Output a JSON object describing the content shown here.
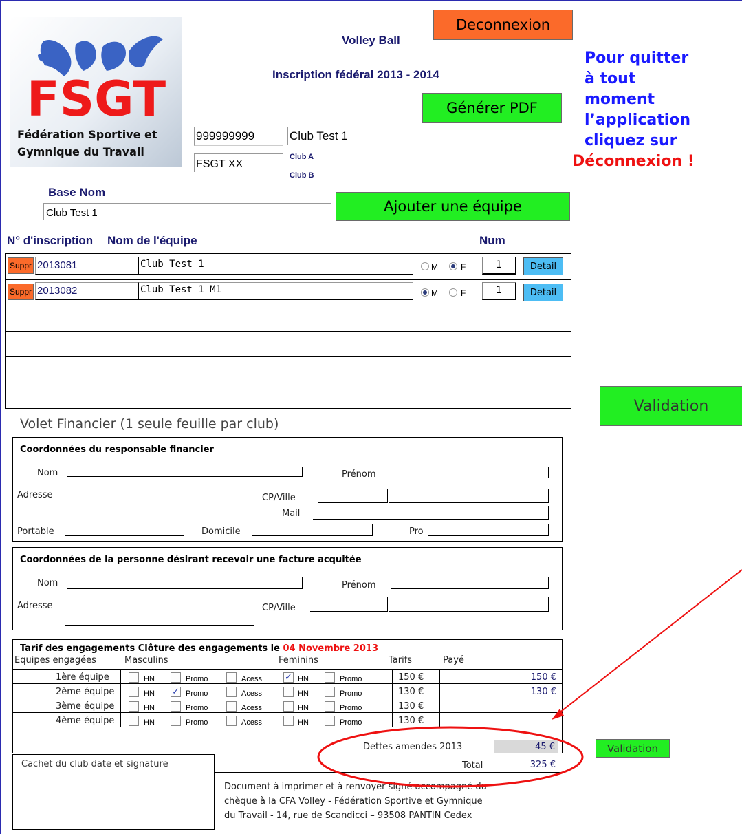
{
  "header": {
    "sport": "Volley Ball",
    "subtitle": "Inscription fédéral 2013 - 2014",
    "logo_text": "FSGT",
    "logo_caption_1": "Fédération Sportive et",
    "logo_caption_2": "Gymnique du Travail",
    "deconnexion_label": "Deconnexion",
    "pdf_label": "Générer PDF"
  },
  "club": {
    "code": "999999999",
    "name": "Club Test 1",
    "committee": "FSGT XX",
    "club_a": "Club A",
    "club_b": "Club B",
    "base_nom_label": "Base Nom",
    "base_nom_value": "Club Test 1",
    "add_team_label": "Ajouter une équipe"
  },
  "help": {
    "line1": "Pour quitter",
    "line2": "à tout",
    "line3": "moment",
    "line4": "l’application",
    "line5": "cliquez sur",
    "line6": "Déconnexion !"
  },
  "teams": {
    "col_number": "N° d'inscription",
    "col_name": "Nom de l'équipe",
    "col_num": "Num",
    "delete_label": "Suppr",
    "detail_label": "Detail",
    "m_label": "M",
    "f_label": "F",
    "rows": [
      {
        "id": "2013081",
        "name": "Club Test 1",
        "gender": "F",
        "num": "1"
      },
      {
        "id": "2013082",
        "name": "Club Test 1 M1",
        "gender": "M",
        "num": "1"
      }
    ]
  },
  "validation_label": "Validation",
  "finance": {
    "title": "Volet Financier (1 seule feuille par club)",
    "resp_title": "Coordonnées du responsable financier",
    "nom": "Nom",
    "prenom": "Prénom",
    "adresse": "Adresse",
    "cpville": "CP/Ville",
    "mail": "Mail",
    "portable": "Portable",
    "domicile": "Domicile",
    "pro": "Pro",
    "invoice_title": "Coordonnées de la personne désirant recevoir une facture acquitée"
  },
  "tarif": {
    "title": "Tarif des engagements Clôture des engagements le",
    "date": "04 Novembre 2013",
    "col_equipes": "Equipes engagées",
    "col_masc": "Masculins",
    "col_fem": "Feminins",
    "col_tarifs": "Tarifs",
    "col_paye": "Payé",
    "hn": "HN",
    "promo": "Promo",
    "acess": "Acess",
    "rows": [
      {
        "label": "1ère équipe",
        "tarif": "150 €",
        "paye": "150 €"
      },
      {
        "label": "2ème équipe",
        "tarif": "130 €",
        "paye": "130 €"
      },
      {
        "label": "3ème équipe",
        "tarif": "130 €",
        "paye": ""
      },
      {
        "label": "4ème équipe",
        "tarif": "130 €",
        "paye": ""
      }
    ],
    "dettes_label": "Dettes amendes 2013",
    "dettes_value": "45 €",
    "total_label": "Total",
    "total_value": "325 €",
    "validation_small": "Validation"
  },
  "footer": {
    "cachet": "Cachet du club date et signature",
    "note_1": "Document à imprimer et à renvoyer signé accompagné du",
    "note_2": "chèque à la CFA Volley - Fédération Sportive et Gymnique",
    "note_3": "du Travail - 14, rue de Scandicci – 93508 PANTIN Cedex"
  },
  "colors": {
    "green": "#22ee22",
    "orange": "#fb6a2a",
    "blue_text": "#1a1aff",
    "red_text": "#ee1111",
    "navy": "#1a1a6e"
  }
}
